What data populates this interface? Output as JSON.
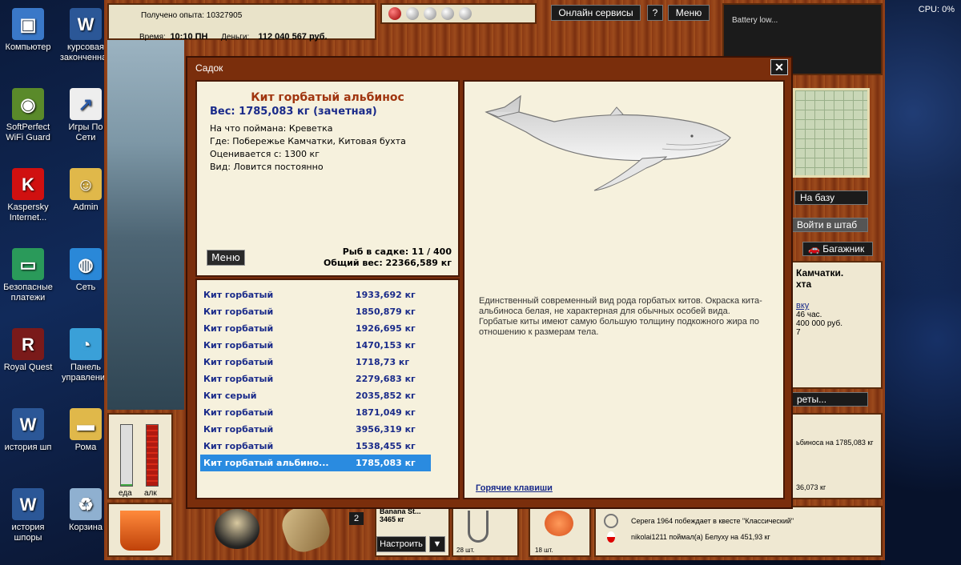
{
  "desktop": {
    "icons": [
      {
        "label": "Компьютер",
        "icon": "computer-icon"
      },
      {
        "label": "курсовая законченная",
        "icon": "word-doc-icon"
      },
      {
        "label": "SoftPerfect WiFi Guard",
        "icon": "owl-icon"
      },
      {
        "label": "Игры По Сети",
        "icon": "shortcut-icon"
      },
      {
        "label": "Kaspersky Internet...",
        "icon": "kaspersky-icon"
      },
      {
        "label": "Admin",
        "icon": "user-folder-icon"
      },
      {
        "label": "Безопасные платежи",
        "icon": "card-icon"
      },
      {
        "label": "Сеть",
        "icon": "network-icon"
      },
      {
        "label": "Royal Quest",
        "icon": "royal-quest-icon"
      },
      {
        "label": "Панель управления",
        "icon": "control-panel-icon"
      },
      {
        "label": "история шп",
        "icon": "word-doc-icon"
      },
      {
        "label": "Рома",
        "icon": "folder-icon"
      },
      {
        "label": "история шпоры",
        "icon": "word-doc-icon"
      },
      {
        "label": "Корзина",
        "icon": "recycle-bin-icon"
      }
    ],
    "cpu": "CPU: 0%"
  },
  "game": {
    "exp_label": "Получено опыта:",
    "exp_value": "10327905",
    "time_label": "Время:",
    "time_value": "10:10 ПН",
    "money_label": "Деньги:",
    "money_value": "112 040 567 руб.",
    "top_buttons": {
      "online": "Онлайн сервисы",
      "help": "?",
      "menu": "Меню"
    },
    "battery": "Battery low...",
    "side_buttons": {
      "base": "На базу",
      "hq": "Войти в штаб",
      "trunk": "Багажник",
      "secrets": "реты..."
    },
    "location_partial": {
      "line1": "Камчатки.",
      "line2": "хта",
      "link": "вку",
      "hours": "46 час.",
      "cost": "400 000 руб.",
      "num": "7"
    },
    "log_partial": {
      "line1": "ьбиноса на 1785,083 кг",
      "line2": "36,073 кг"
    },
    "meters": {
      "food_label": "еда",
      "alc_label": "алк",
      "food_level": 0.02,
      "alc_level": 1.0
    },
    "slots": {
      "count_badge": "2",
      "bait_name": "Banana St...",
      "bait_weight": "3465 кг",
      "configure": "Настроить",
      "hooks_count": "28 шт.",
      "shrimp_count": "18 шт."
    },
    "news": [
      "Серега 1964 побеждает в квесте \"Классический\"",
      "nikolai1211 поймал(а) Белуху на 451,93 кг"
    ]
  },
  "modal": {
    "title": "Садок",
    "close": "✕",
    "selected_fish": {
      "name": "Кит горбатый альбинос",
      "weight": "Вес: 1785,083 кг (зачетная)",
      "caught_on": "На что поймана: Креветка",
      "where": "Где: Побережье Камчатки, Китовая бухта",
      "valued_from": "Оценивается с: 1300 кг",
      "kind": "Вид: Ловится постоянно"
    },
    "menu_button": "Меню",
    "fish_in_keep": "Рыб в садке: 11 / 400",
    "total_weight": "Общий вес: 22366,589 кг",
    "fish_list": [
      {
        "name": "Кит горбатый",
        "weight": "1933,692 кг"
      },
      {
        "name": "Кит горбатый",
        "weight": "1850,879 кг"
      },
      {
        "name": "Кит горбатый",
        "weight": "1926,695 кг"
      },
      {
        "name": "Кит горбатый",
        "weight": "1470,153 кг"
      },
      {
        "name": "Кит горбатый",
        "weight": "1718,73 кг"
      },
      {
        "name": "Кит горбатый",
        "weight": "2279,683 кг"
      },
      {
        "name": "Кит серый",
        "weight": "2035,852 кг"
      },
      {
        "name": "Кит горбатый",
        "weight": "1871,049 кг"
      },
      {
        "name": "Кит горбатый",
        "weight": "3956,319 кг"
      },
      {
        "name": "Кит горбатый",
        "weight": "1538,455 кг"
      },
      {
        "name": "Кит горбатый альбино...",
        "weight": "1785,083 кг"
      }
    ],
    "description": "Единственный современный вид рода горбатых китов. Окраска кита-альбиноса белая, не характерная для обычных особей вида. Горбатые киты имеют самую большую толщину подкожного жира по отношению к размерам тела.",
    "hotkeys": "Горячие клавиши"
  }
}
